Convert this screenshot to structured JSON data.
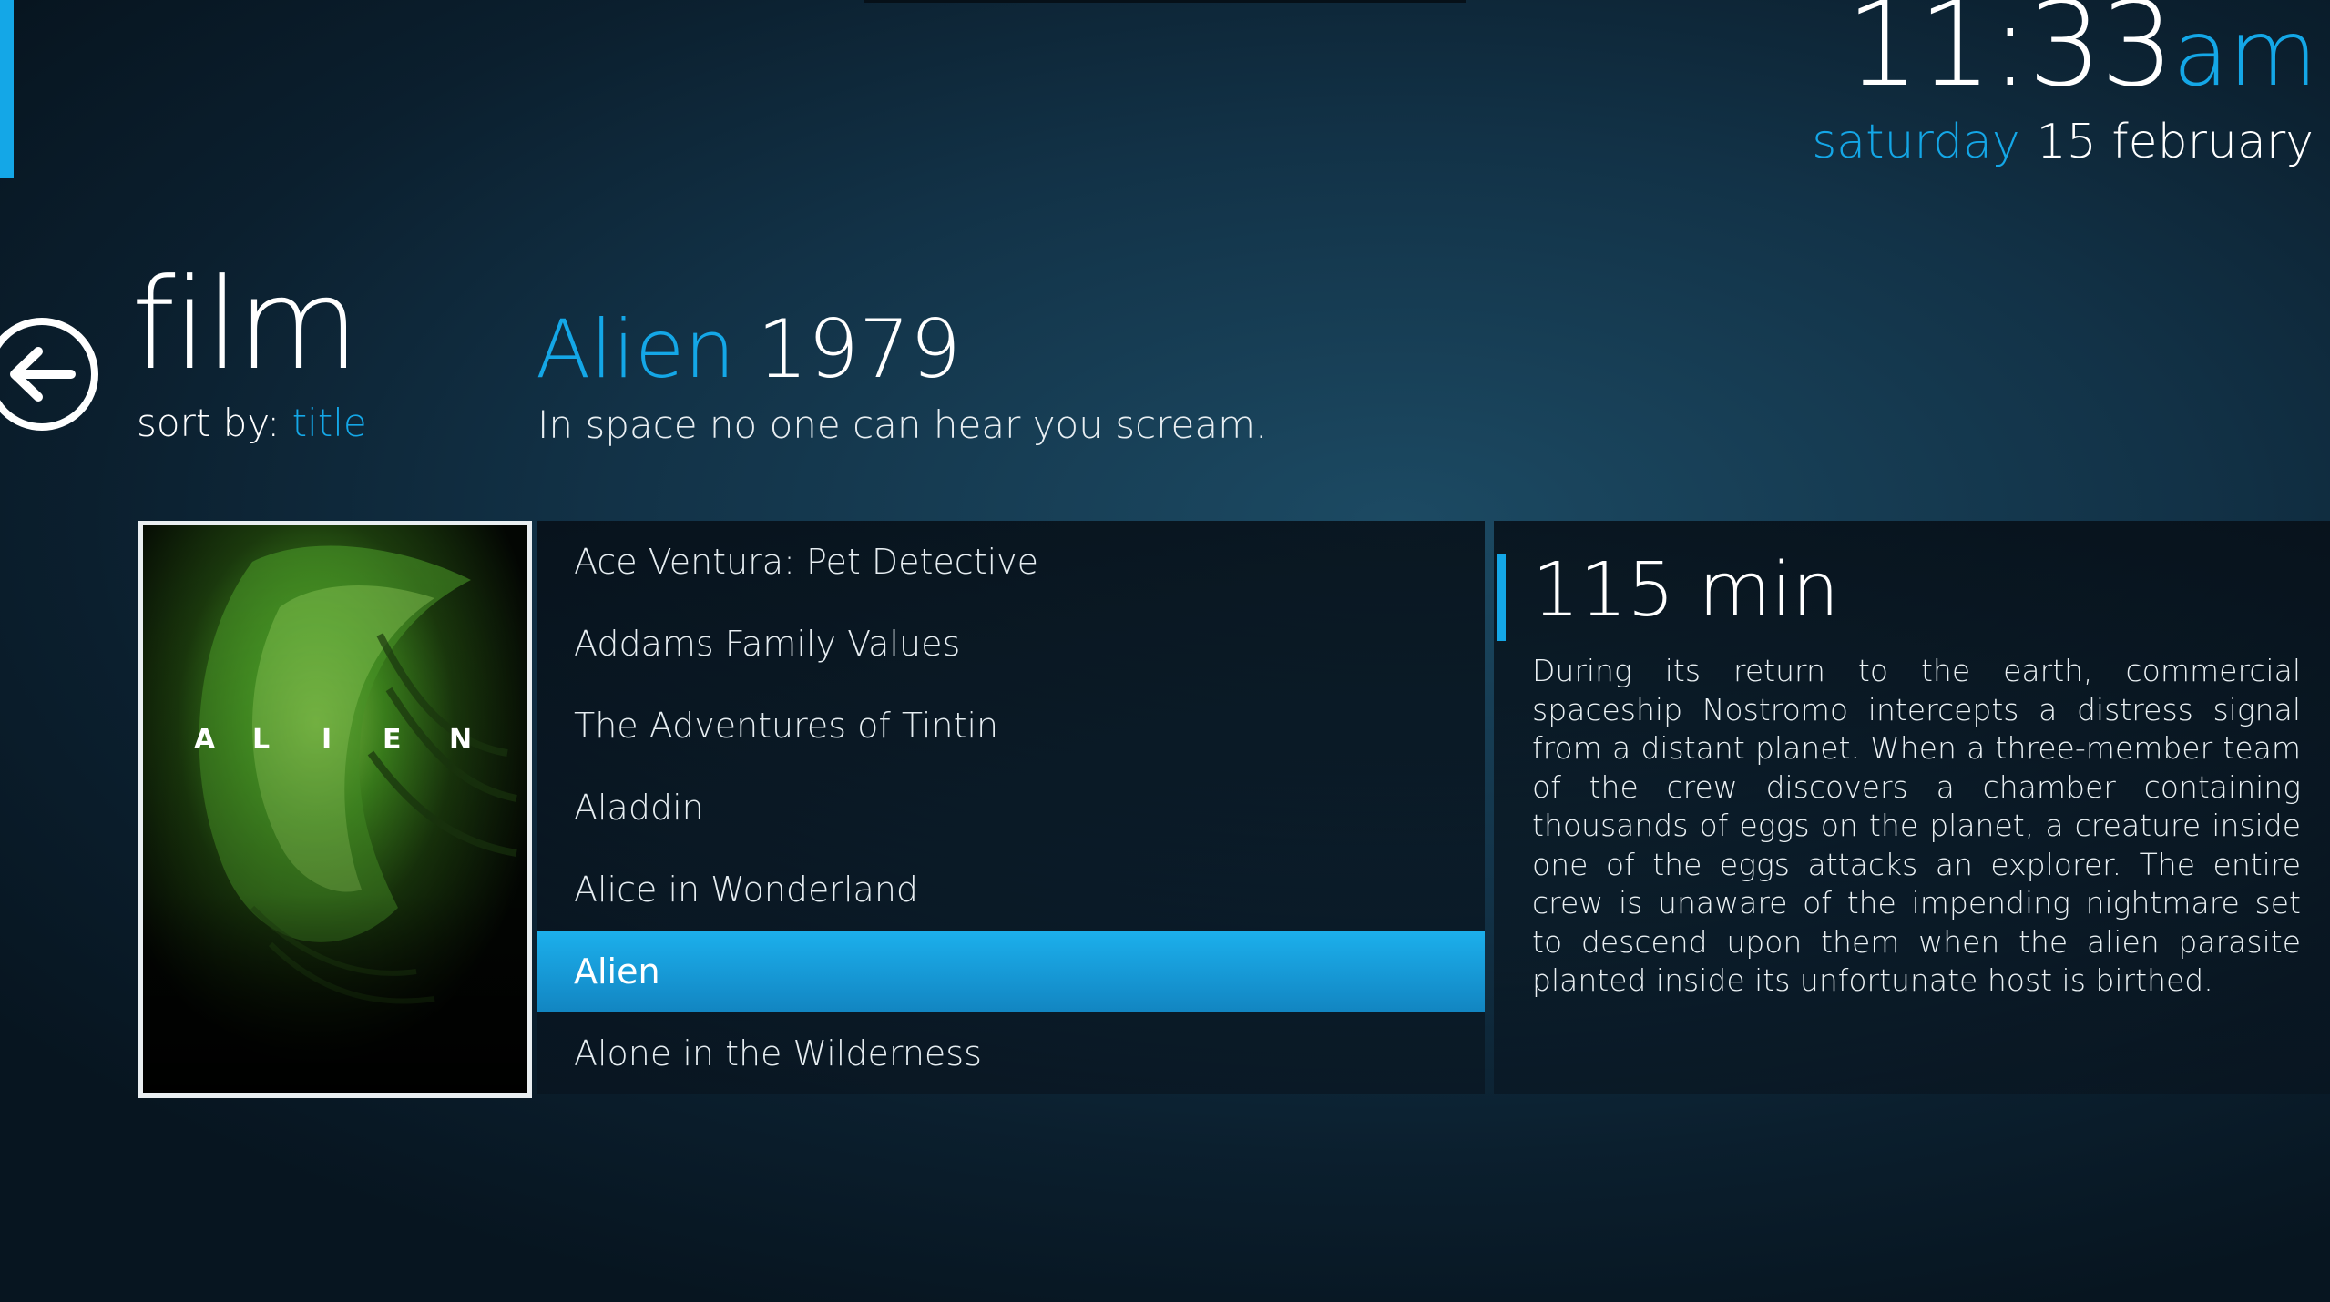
{
  "clock": {
    "time": "11:33",
    "ampm": "am"
  },
  "date": {
    "day": "saturday",
    "date": "15 february"
  },
  "section": {
    "title": "film",
    "sort_prefix": "sort by:",
    "sort_value": "title"
  },
  "movie": {
    "title": "Alien",
    "year": "1979",
    "tagline": "In space no one can hear you scream.",
    "runtime": "115 min",
    "plot": "During its return to the earth, commercial spaceship Nostromo intercepts a distress signal from a distant planet. When a three-member team of the crew discovers a chamber containing thousands of eggs on the planet, a creature inside one of the eggs attacks an explorer. The entire crew is unaware of the impending nightmare set to descend upon them when the alien parasite planted inside its unfortunate host is birthed."
  },
  "poster": {
    "letters": [
      "A",
      "L",
      "I",
      "E",
      "N"
    ]
  },
  "list": {
    "selected_index": 5,
    "items": [
      "Ace Ventura: Pet Detective",
      "Addams Family Values",
      "The Adventures of Tintin",
      "Aladdin",
      "Alice in Wonderland",
      "Alien",
      "Alone in the Wilderness"
    ]
  },
  "icons": {
    "back": "arrow-left-circle-icon"
  },
  "colors": {
    "accent": "#14a7e7",
    "background": "#123247"
  }
}
